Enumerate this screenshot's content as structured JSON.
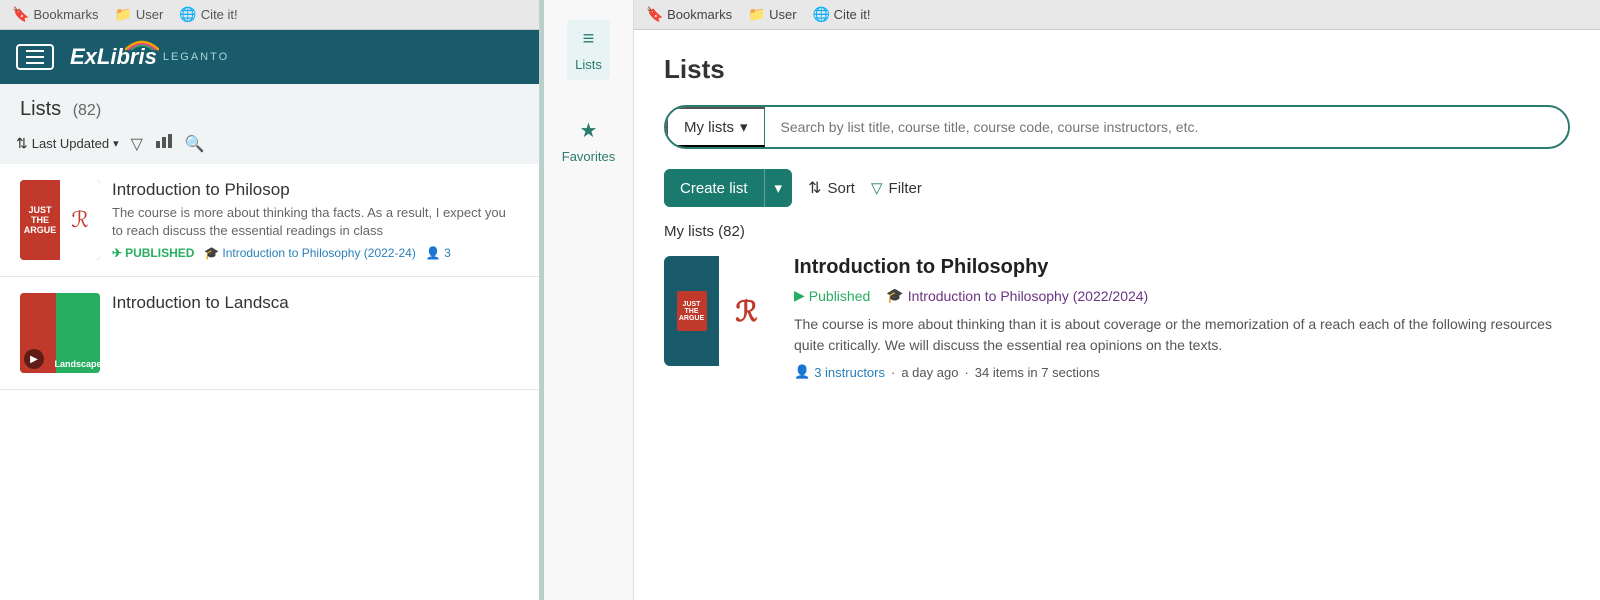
{
  "left": {
    "topbar": {
      "bookmarks": "Bookmarks",
      "user": "User",
      "cite": "Cite it!"
    },
    "header": {
      "logoEx": "Ex",
      "logoLibris": "Libris",
      "logoSub": "LEGANTO"
    },
    "listsTitle": "Lists",
    "listsCount": "(82)",
    "sortLabel": "Last Updated",
    "items": [
      {
        "title": "Introduction to Philosop",
        "description": "The course is more about thinking tha facts. As a result, I expect you to reach discuss the essential readings in class",
        "status": "PUBLISHED",
        "course": "Introduction to Philosophy (2022-24)",
        "users": "3"
      },
      {
        "title": "Introduction to Landsca",
        "description": "",
        "status": "",
        "course": "",
        "users": ""
      }
    ]
  },
  "middle": {
    "lists": {
      "label": "Lists",
      "icon": "≡"
    },
    "favorites": {
      "label": "Favorites",
      "icon": "★"
    }
  },
  "right": {
    "topbar": {
      "bookmarks": "Bookmarks",
      "user": "User",
      "cite": "Cite it!"
    },
    "title": "Lists",
    "search": {
      "dropdownLabel": "My lists",
      "placeholder": "Search by list title, course title, course code, course instructors, etc."
    },
    "actions": {
      "createList": "Create list",
      "sort": "Sort",
      "filter": "Filter"
    },
    "myListsLabel": "My lists (82)",
    "card": {
      "title": "Introduction to Philosophy",
      "published": "Published",
      "course": "Introduction to Philosophy (2022/2024)",
      "description": "The course is more about thinking than it is about coverage or the memorization of a reach each of the following resources quite critically. We will discuss the essential rea opinions on the texts.",
      "instructors": "3 instructors",
      "time": "a day ago",
      "items": "34 items in 7 sections"
    }
  }
}
